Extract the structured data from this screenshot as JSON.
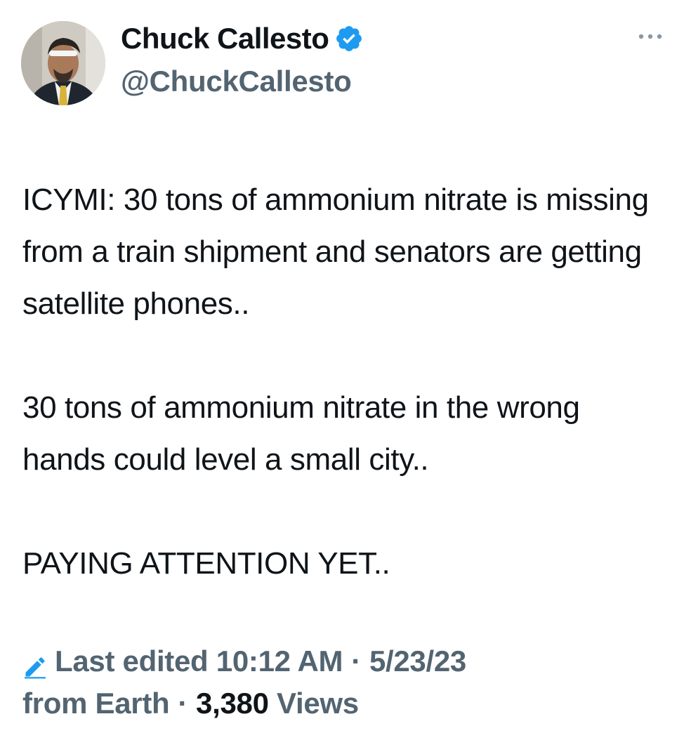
{
  "author": {
    "display_name": "Chuck Callesto",
    "handle": "@ChuckCallesto",
    "verified": true,
    "avatar_icon": "profile-photo"
  },
  "menu": {
    "icon": "more-horizontal-icon"
  },
  "tweet": {
    "paragraphs": [
      "ICYMI: 30 tons of ammonium nitrate is missing from a train shipment and senators are getting satellite phones..",
      "30 tons of ammonium nitrate in the wrong hands could level a small city..",
      "PAYING ATTENTION YET.."
    ]
  },
  "meta": {
    "edit_icon": "pencil-icon",
    "edited_label": "Last edited",
    "time": "10:12 AM",
    "separator": "·",
    "date": "5/23/23",
    "source": "from Earth",
    "views_count": "3,380",
    "views_label": "Views"
  },
  "colors": {
    "text": "#0f1419",
    "secondary": "#536471",
    "verified_blue": "#1d9bf0"
  }
}
